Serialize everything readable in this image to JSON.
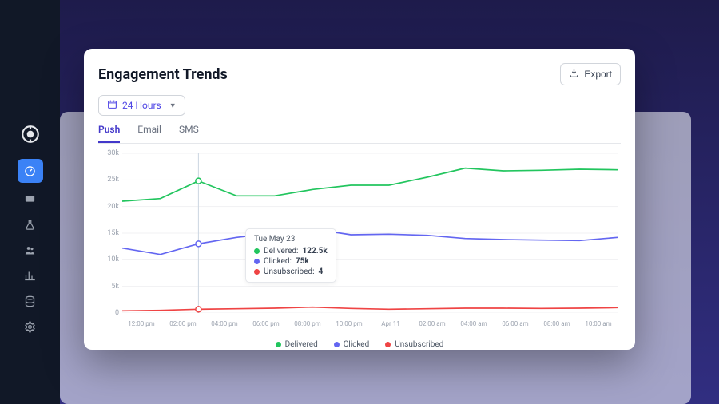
{
  "sidebar": {
    "items": [
      {
        "name": "logo"
      },
      {
        "name": "gauge",
        "active": true
      },
      {
        "name": "message"
      },
      {
        "name": "flask"
      },
      {
        "name": "users"
      },
      {
        "name": "bars"
      },
      {
        "name": "database"
      },
      {
        "name": "gear"
      }
    ]
  },
  "modal": {
    "title": "Engagement Trends",
    "export_label": "Export",
    "range_label": "24 Hours",
    "tabs": [
      {
        "label": "Push",
        "active": true
      },
      {
        "label": "Email",
        "active": false
      },
      {
        "label": "SMS",
        "active": false
      }
    ]
  },
  "tooltip": {
    "date": "Tue May 23",
    "rows": [
      {
        "label": "Delivered:",
        "value": "122.5k",
        "color": "g"
      },
      {
        "label": "Clicked:",
        "value": "75k",
        "color": "b"
      },
      {
        "label": "Unsubscribed:",
        "value": "4",
        "color": "r"
      }
    ]
  },
  "legend": [
    {
      "label": "Delivered",
      "color": "g"
    },
    {
      "label": "Clicked",
      "color": "b"
    },
    {
      "label": "Unsubscribed",
      "color": "r"
    }
  ],
  "chart_data": {
    "type": "line",
    "title": "Engagement Trends",
    "xlabel": "",
    "ylabel": "",
    "ylim": [
      0,
      30000
    ],
    "y_ticks": [
      "0",
      "5k",
      "10k",
      "15k",
      "20k",
      "25k",
      "30k"
    ],
    "categories": [
      "12:00 pm",
      "02:00 pm",
      "04:00 pm",
      "06:00 pm",
      "08:00 pm",
      "10:00 pm",
      "Apr 11",
      "02:00 am",
      "04:00 am",
      "06:00 am",
      "08:00 am",
      "10:00 am"
    ],
    "series": [
      {
        "name": "Delivered",
        "color": "#22c55e",
        "values": [
          21000,
          21500,
          24800,
          22000,
          22000,
          23200,
          24000,
          24000,
          25500,
          27200,
          26700,
          26800,
          27000,
          26900
        ]
      },
      {
        "name": "Clicked",
        "color": "#6366f1",
        "values": [
          12200,
          11000,
          13000,
          14200,
          15000,
          15800,
          14700,
          14800,
          14600,
          14000,
          13800,
          13700,
          13600,
          14200
        ]
      },
      {
        "name": "Unsubscribed",
        "color": "#ef4444",
        "values": [
          400,
          500,
          700,
          800,
          900,
          1100,
          850,
          700,
          800,
          900,
          900,
          850,
          900,
          1000
        ]
      }
    ],
    "hover_index": 2
  }
}
